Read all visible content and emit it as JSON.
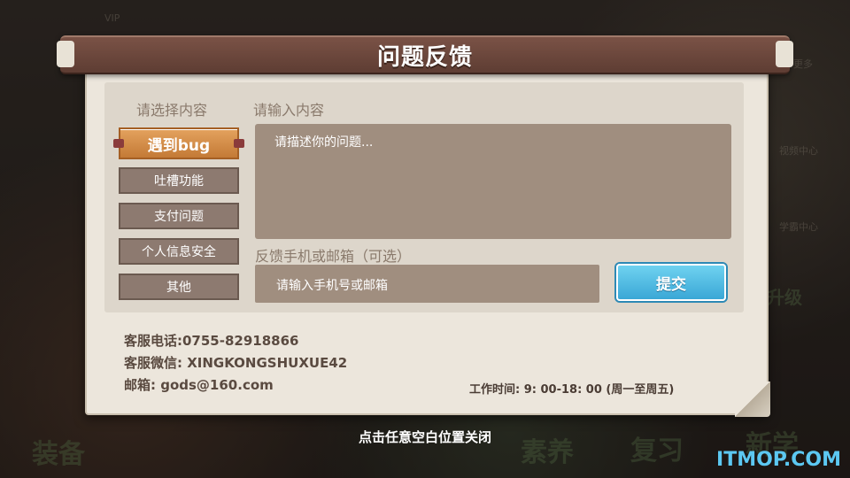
{
  "dialog": {
    "title": "问题反馈",
    "select_heading": "请选择内容",
    "input_heading": "请输入内容",
    "categories": [
      {
        "label": "遇到bug",
        "selected": true
      },
      {
        "label": "吐槽功能",
        "selected": false
      },
      {
        "label": "支付问题",
        "selected": false
      },
      {
        "label": "个人信息安全",
        "selected": false
      },
      {
        "label": "其他",
        "selected": false
      }
    ],
    "description_placeholder": "请描述你的问题...",
    "contact_heading": "反馈手机或邮箱（可选）",
    "contact_placeholder": "请输入手机号或邮箱",
    "submit_label": "提交",
    "phone": "客服电话:0755-82918866",
    "wechat": "客服微信: XINGKONGSHUXUE42",
    "email": "邮箱: gods@160.com",
    "hours": "工作时间: 9: 00-18: 00 (周一至周五)"
  },
  "close_hint": "点击任意空白位置关闭",
  "watermark": "ITMOP.COM",
  "background": {
    "labels": [
      "装备",
      "素养",
      "复习",
      "新学",
      "升级",
      "更多",
      "视频中心",
      "学霸中心",
      "VIP"
    ]
  },
  "colors": {
    "banner": "#6a463b",
    "selected_category": "#d48d4a",
    "category": "#8d7a70",
    "input_fill": "#a08e7f",
    "submit": "#4bb8e2"
  }
}
